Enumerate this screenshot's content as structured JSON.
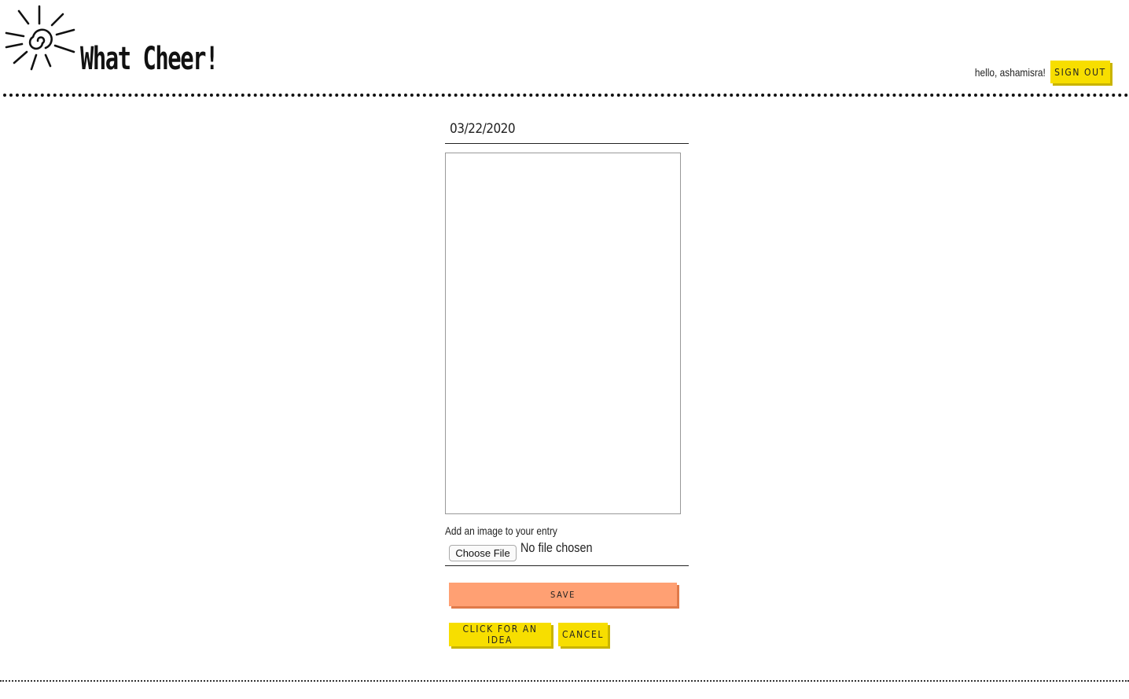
{
  "header": {
    "app_title": "What Cheer!",
    "logo_icon": "sun-icon",
    "greeting": "hello, ashamisra!",
    "sign_out_label": "Sign Out"
  },
  "entry_form": {
    "date_value": "03/22/2020",
    "entry_text": "",
    "image_label": "Add an image to your entry",
    "choose_file_label": "Choose File",
    "no_file_text": "No file chosen",
    "save_label": "Save",
    "idea_label": "Click for an idea",
    "cancel_label": "Cancel"
  },
  "colors": {
    "accent_yellow": "#f7de00",
    "save_orange": "#ffa073",
    "text": "#111111"
  }
}
